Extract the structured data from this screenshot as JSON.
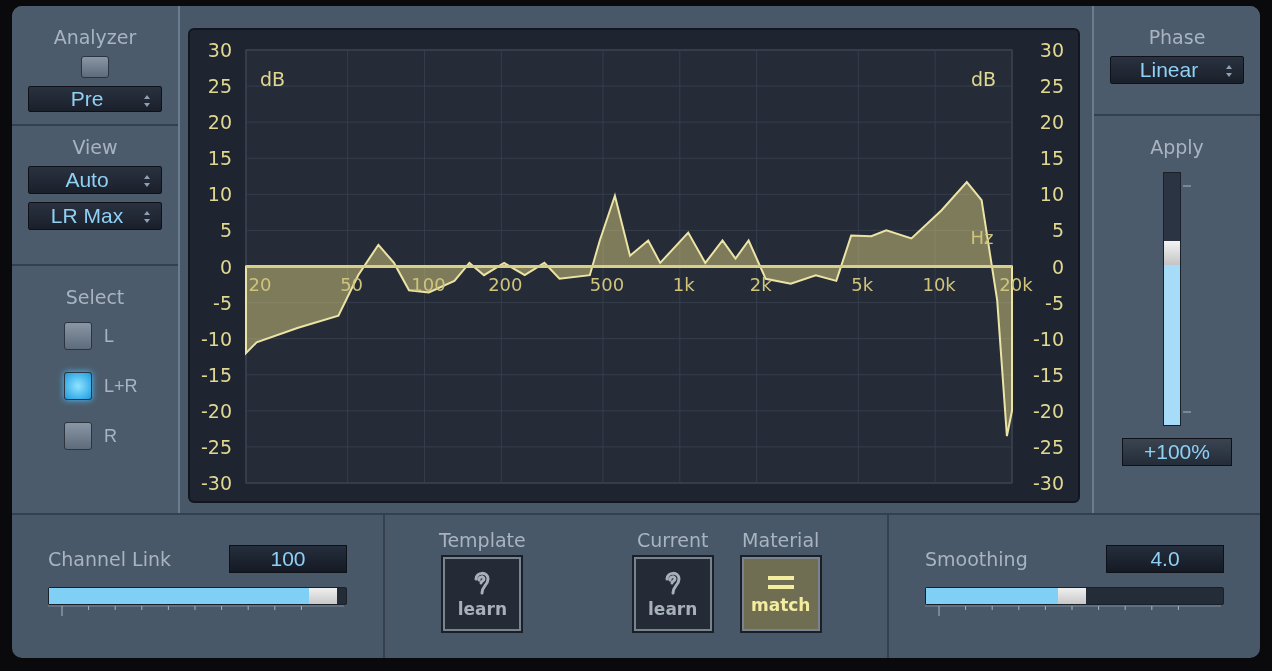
{
  "analyzer": {
    "label": "Analyzer",
    "on": false,
    "mode": "Pre"
  },
  "view": {
    "label": "View",
    "scale": "Auto",
    "channel": "LR Max"
  },
  "select": {
    "label": "Select",
    "options": [
      {
        "label": "L",
        "selected": false
      },
      {
        "label": "L+R",
        "selected": true
      },
      {
        "label": "R",
        "selected": false
      }
    ]
  },
  "graph": {
    "left_ticks": [
      "30",
      "25",
      "20",
      "15",
      "10",
      "5",
      "0",
      "-5",
      "-10",
      "-15",
      "-20",
      "-25",
      "-30"
    ],
    "right_ticks": [
      "30",
      "25",
      "20",
      "15",
      "10",
      "5",
      "0",
      "-5",
      "-10",
      "-15",
      "-20",
      "-25",
      "-30"
    ],
    "left_unit": "dB",
    "right_unit": "dB",
    "freq_labels": [
      "20",
      "50",
      "100",
      "200",
      "500",
      "1k",
      "2k",
      "5k",
      "10k",
      "20k"
    ],
    "freq_unit": "Hz"
  },
  "phase": {
    "label": "Phase",
    "value": "Linear"
  },
  "apply": {
    "label": "Apply",
    "level": 0.66,
    "reading": "+100%"
  },
  "channel_link": {
    "label": "Channel Link",
    "value": "100",
    "level": 0.97
  },
  "learn_buttons": [
    {
      "label": "Template",
      "button": "learn",
      "kind": "learn",
      "active": false
    },
    {
      "label": "Current",
      "button": "learn",
      "kind": "learn",
      "active": false
    },
    {
      "label": "Material",
      "button": "match",
      "kind": "match",
      "active": true
    }
  ],
  "smoothing": {
    "label": "Smoothing",
    "value": "4.0",
    "level": 0.49
  }
}
